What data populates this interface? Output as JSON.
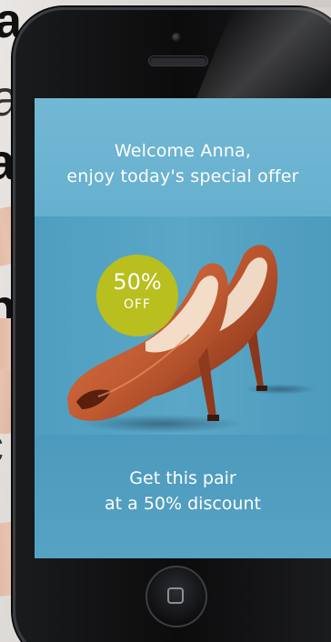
{
  "background": {
    "letters": [
      "a",
      "a",
      "a",
      "n",
      "c"
    ]
  },
  "screen": {
    "welcome_line1": "Welcome Anna,",
    "welcome_line2": "enjoy today's special offer",
    "badge_percent": "50%",
    "badge_off": "OFF",
    "discount_line1": "Get this pair",
    "discount_line2": "at a 50% discount"
  },
  "colors": {
    "screen_blue": "#5aa7c7",
    "badge_green": "#b8bf1e",
    "shoe_leather": "#b8532d"
  },
  "icons": {
    "home": "home-square-icon",
    "camera": "front-camera-icon",
    "speaker": "speaker-grille-icon"
  }
}
